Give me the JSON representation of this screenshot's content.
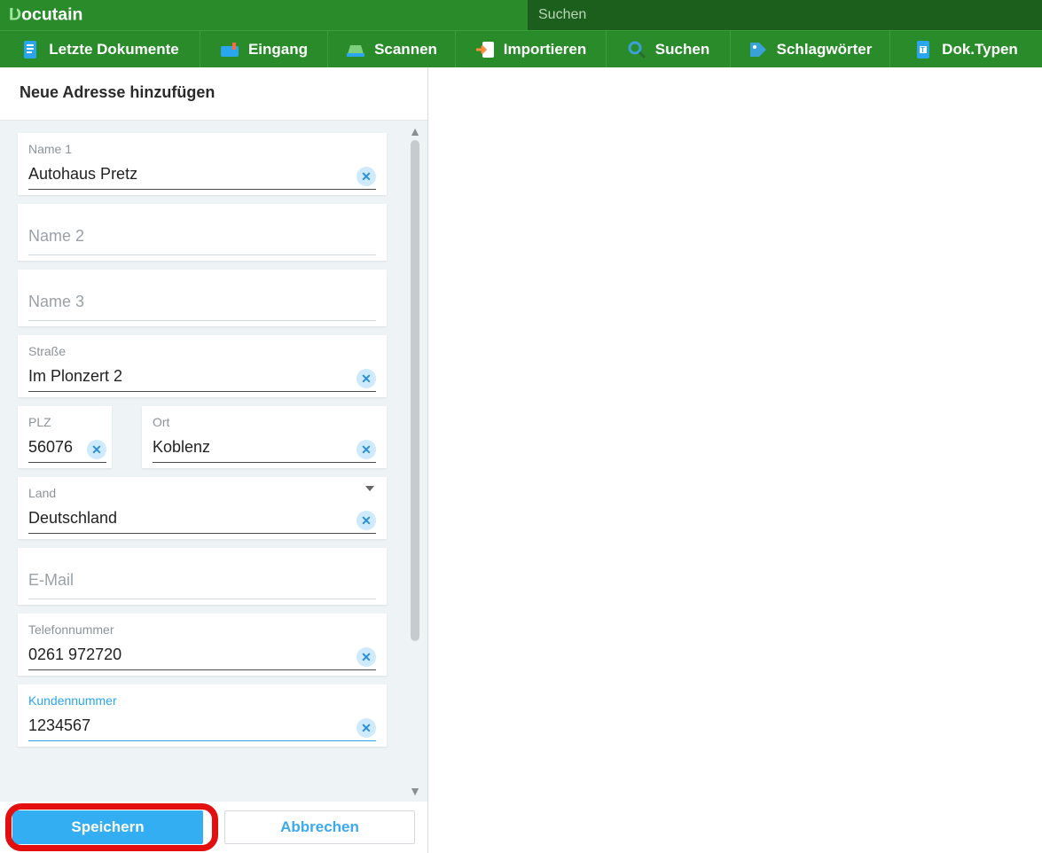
{
  "brand": {
    "name": "Docutain"
  },
  "search": {
    "placeholder": "Suchen"
  },
  "toolbar": {
    "items": [
      {
        "label": "Letzte Dokumente"
      },
      {
        "label": "Eingang"
      },
      {
        "label": "Scannen"
      },
      {
        "label": "Importieren"
      },
      {
        "label": "Suchen"
      },
      {
        "label": "Schlagwörter"
      },
      {
        "label": "Dok.Typen"
      }
    ]
  },
  "panel": {
    "title": "Neue Adresse hinzufügen"
  },
  "form": {
    "name1": {
      "label": "Name 1",
      "value": "Autohaus Pretz"
    },
    "name2": {
      "placeholder": "Name 2",
      "value": ""
    },
    "name3": {
      "placeholder": "Name 3",
      "value": ""
    },
    "strasse": {
      "label": "Straße",
      "value": "Im Plonzert 2"
    },
    "plz": {
      "label": "PLZ",
      "value": "56076"
    },
    "ort": {
      "label": "Ort",
      "value": "Koblenz"
    },
    "land": {
      "label": "Land",
      "value": "Deutschland"
    },
    "email": {
      "placeholder": "E-Mail",
      "value": ""
    },
    "telefon": {
      "label": "Telefonnummer",
      "value": "0261 972720"
    },
    "kundennr": {
      "label": "Kundennummer",
      "value": "1234567"
    }
  },
  "footer": {
    "save": "Speichern",
    "cancel": "Abbrechen"
  }
}
